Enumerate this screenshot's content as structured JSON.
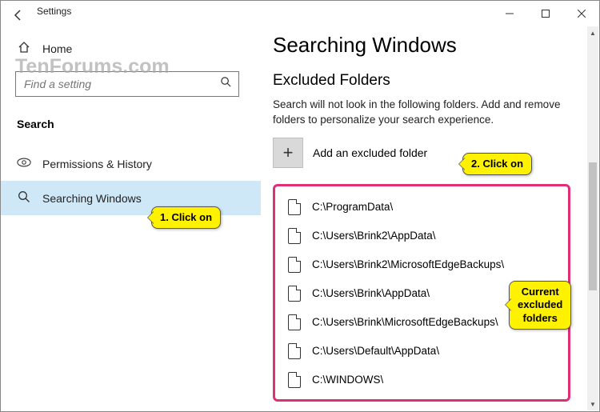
{
  "window": {
    "title": "Settings"
  },
  "sidebar": {
    "home_label": "Home",
    "search_placeholder": "Find a setting",
    "category": "Search",
    "items": [
      {
        "label": "Permissions & History"
      },
      {
        "label": "Searching Windows"
      }
    ]
  },
  "main": {
    "heading": "Searching Windows",
    "subheading": "Excluded Folders",
    "description": "Search will not look in the following folders. Add and remove folders to personalize your search experience.",
    "add_label": "Add an excluded folder",
    "folders": [
      "C:\\ProgramData\\",
      "C:\\Users\\Brink2\\AppData\\",
      "C:\\Users\\Brink2\\MicrosoftEdgeBackups\\",
      "C:\\Users\\Brink\\AppData\\",
      "C:\\Users\\Brink\\MicrosoftEdgeBackups\\",
      "C:\\Users\\Default\\AppData\\",
      "C:\\WINDOWS\\"
    ]
  },
  "annotations": {
    "callout1": "1. Click on",
    "callout2": "2. Click on",
    "callout3_l1": "Current",
    "callout3_l2": "excluded",
    "callout3_l3": "folders"
  },
  "watermark": "TenForums.com"
}
